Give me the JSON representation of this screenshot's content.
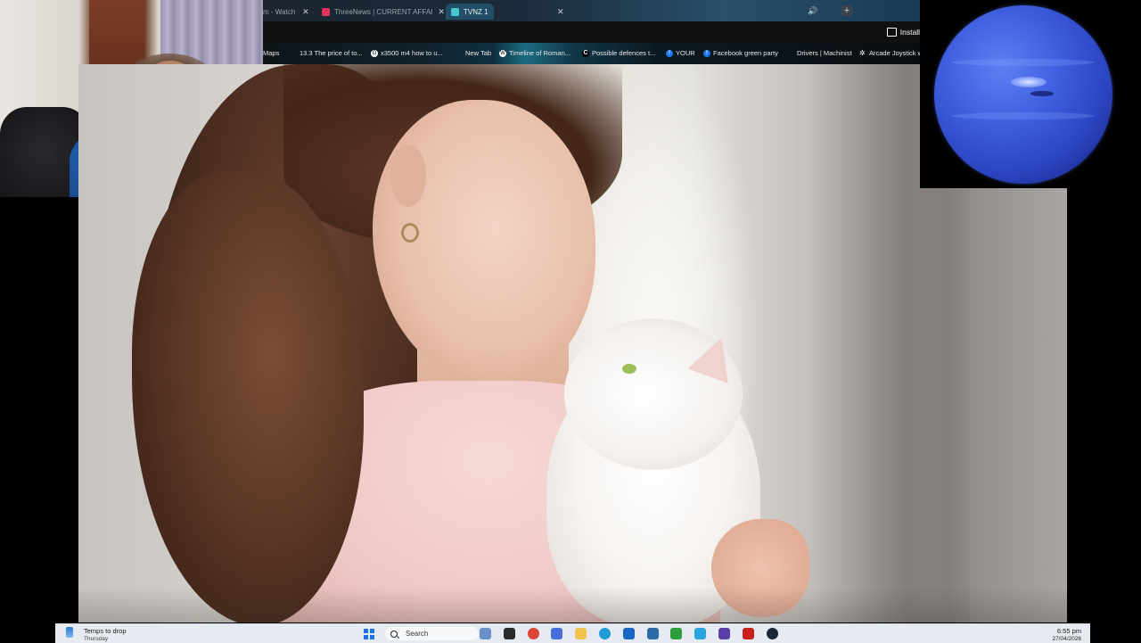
{
  "browser": {
    "tabs": [
      {
        "label": "m - Watch",
        "active": false,
        "icon": "none"
      },
      {
        "label": "ThreeNews | CURRENT AFFAI",
        "active": false,
        "icon": "threenews-icon"
      },
      {
        "label": "TVNZ 1",
        "active": true,
        "icon": "tvnz-icon"
      }
    ],
    "close_glyph": "✕",
    "sound_glyph": "🔊",
    "new_tab_glyph": "+",
    "install_label": "Install",
    "bookmarks": [
      {
        "label": "Maps",
        "icon": "none"
      },
      {
        "label": "13.3 The price of to...",
        "icon": "none"
      },
      {
        "label": "x3500 m4 how to u...",
        "icon": "google-icon",
        "glyph": "G"
      },
      {
        "label": "New Tab",
        "icon": "none"
      },
      {
        "label": "Timeline of Roman...",
        "icon": "wikipedia-icon",
        "glyph": "W"
      },
      {
        "label": "Possible defences t...",
        "icon": "claude-icon",
        "glyph": "C"
      },
      {
        "label": "YOUR",
        "icon": "facebook-icon",
        "glyph": "f"
      },
      {
        "label": "Facebook green party",
        "icon": "facebook-icon",
        "glyph": "f"
      },
      {
        "label": "Drivers | Machinist",
        "icon": "none"
      },
      {
        "label": "Arcade Joystick w",
        "icon": "gear-icon",
        "glyph": "✲"
      }
    ]
  },
  "taskbar": {
    "weather_line1": "Temps to drop",
    "weather_line2": "Thursday",
    "search_label": "Search",
    "time": "6:55 pm",
    "date": "27/04/2026",
    "pinned_icons": [
      {
        "name": "widgets-icon",
        "color": "#6b8fc9"
      },
      {
        "name": "terminal-icon",
        "color": "#2b2b2b"
      },
      {
        "name": "chrome-icon",
        "color": "#db4437"
      },
      {
        "name": "store-icon",
        "color": "#4a6fd8"
      },
      {
        "name": "file-explorer-icon",
        "color": "#f2c14e"
      },
      {
        "name": "edge-icon",
        "color": "#1f9bd7"
      },
      {
        "name": "outlook-icon",
        "color": "#1a66c4"
      },
      {
        "name": "calculator-icon",
        "color": "#2f6aa8"
      },
      {
        "name": "xbox-icon",
        "color": "#2b9d3a"
      },
      {
        "name": "telegram-icon",
        "color": "#2aa3dc"
      },
      {
        "name": "app-icon",
        "color": "#5b3fa8"
      },
      {
        "name": "flash-icon",
        "color": "#c8201d"
      },
      {
        "name": "steam-icon",
        "color": "#1b2838"
      }
    ]
  },
  "colors": {
    "taskbar_bg": "#e6ebf1",
    "planet_blue": "#3f5fe0"
  }
}
